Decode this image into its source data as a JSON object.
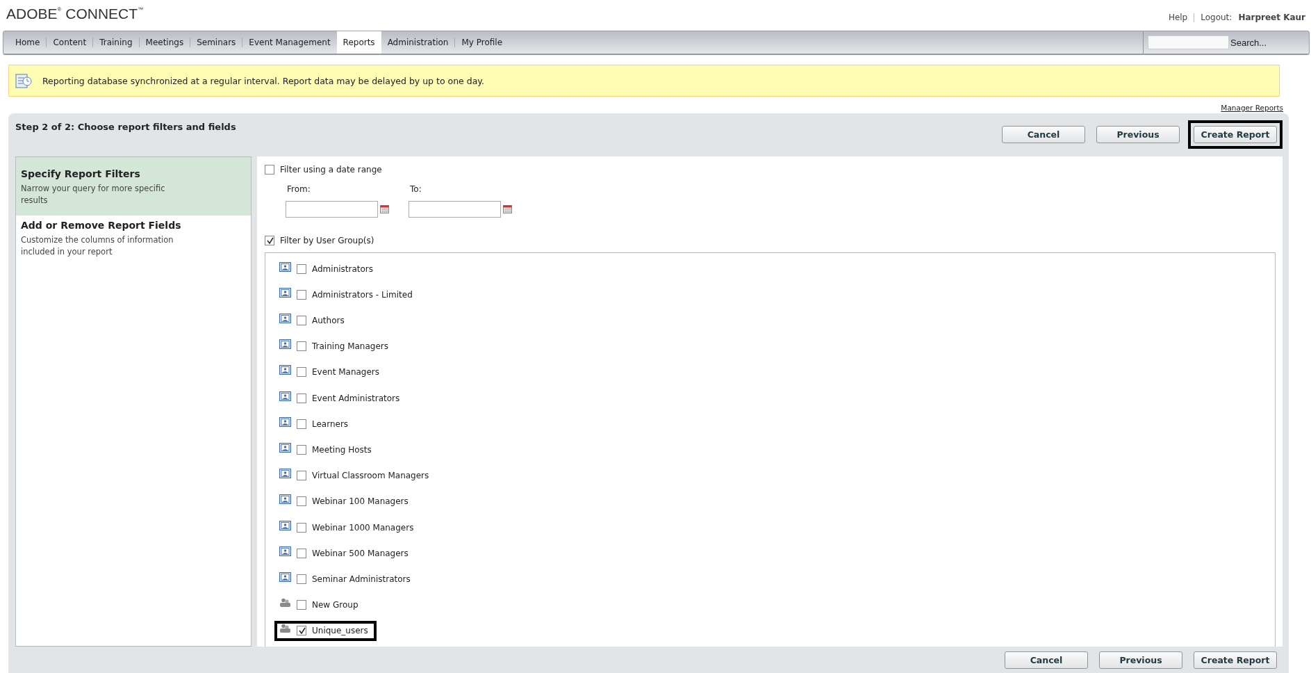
{
  "header": {
    "logo": "ADOBE",
    "logo_mark": "®",
    "logo_word": "CONNECT",
    "logo_tm": "™",
    "help": "Help",
    "logout_label": "Logout:",
    "user": "Harpreet Kaur"
  },
  "nav": {
    "tabs": [
      {
        "label": "Home",
        "selected": false
      },
      {
        "label": "Content",
        "selected": false
      },
      {
        "label": "Training",
        "selected": false
      },
      {
        "label": "Meetings",
        "selected": false
      },
      {
        "label": "Seminars",
        "selected": false
      },
      {
        "label": "Event Management",
        "selected": false
      },
      {
        "label": "Reports",
        "selected": true
      },
      {
        "label": "Administration",
        "selected": false
      },
      {
        "label": "My Profile",
        "selected": false
      }
    ],
    "search_button": "Search..."
  },
  "notice": "Reporting database synchronized at a regular interval. Report data may be delayed by up to one day.",
  "manager_reports_link": "Manager Reports",
  "wizard": {
    "title": "Step 2 of 2: Choose report filters and fields",
    "top_buttons": [
      {
        "label": "Cancel",
        "highlighted": false
      },
      {
        "label": "Previous",
        "highlighted": false
      },
      {
        "label": "Create Report",
        "highlighted": true
      }
    ],
    "steps": [
      {
        "title": "Specify Report Filters",
        "description": "Narrow your query for more specific results",
        "selected": true
      },
      {
        "title": "Add or Remove Report Fields",
        "description": "Customize the columns of information included in your report",
        "selected": false
      }
    ],
    "date_filter": {
      "label": "Filter using a date range",
      "checked": false,
      "from_label": "From:",
      "to_label": "To:"
    },
    "group_filter": {
      "label": "Filter by User Group(s)",
      "checked": true
    },
    "groups": [
      {
        "name": "Administrators",
        "kind": "role",
        "checked": false,
        "highlighted": false
      },
      {
        "name": "Administrators - Limited",
        "kind": "role",
        "checked": false,
        "highlighted": false
      },
      {
        "name": "Authors",
        "kind": "role",
        "checked": false,
        "highlighted": false
      },
      {
        "name": "Training Managers",
        "kind": "role",
        "checked": false,
        "highlighted": false
      },
      {
        "name": "Event Managers",
        "kind": "role",
        "checked": false,
        "highlighted": false
      },
      {
        "name": "Event Administrators",
        "kind": "role",
        "checked": false,
        "highlighted": false
      },
      {
        "name": "Learners",
        "kind": "role",
        "checked": false,
        "highlighted": false
      },
      {
        "name": "Meeting Hosts",
        "kind": "role",
        "checked": false,
        "highlighted": false
      },
      {
        "name": "Virtual Classroom Managers",
        "kind": "role",
        "checked": false,
        "highlighted": false
      },
      {
        "name": "Webinar 100 Managers",
        "kind": "role",
        "checked": false,
        "highlighted": false
      },
      {
        "name": "Webinar 1000 Managers",
        "kind": "role",
        "checked": false,
        "highlighted": false
      },
      {
        "name": "Webinar 500 Managers",
        "kind": "role",
        "checked": false,
        "highlighted": false
      },
      {
        "name": "Seminar Administrators",
        "kind": "role",
        "checked": false,
        "highlighted": false
      },
      {
        "name": "New Group",
        "kind": "custom",
        "checked": false,
        "highlighted": false
      },
      {
        "name": "Unique_users",
        "kind": "custom",
        "checked": true,
        "highlighted": true
      }
    ],
    "bottom_buttons": [
      {
        "label": "Cancel",
        "highlighted": false
      },
      {
        "label": "Previous",
        "highlighted": false
      },
      {
        "label": "Create Report",
        "highlighted": false
      }
    ]
  }
}
